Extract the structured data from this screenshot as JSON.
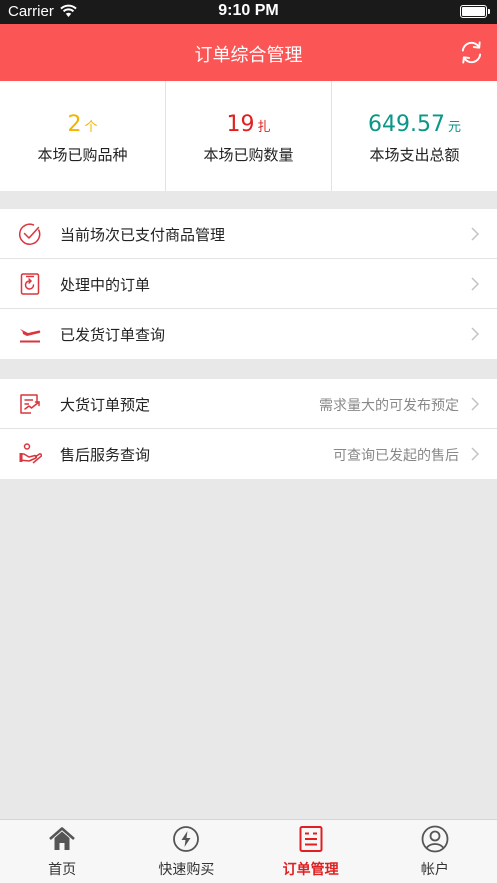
{
  "status_bar": {
    "carrier": "Carrier",
    "time": "9:10 PM"
  },
  "header": {
    "title": "订单综合管理",
    "refresh_icon": "refresh-icon"
  },
  "stats": [
    {
      "value": "2",
      "unit": "个",
      "label": "本场已购品种",
      "color": "#f2b400"
    },
    {
      "value": "19",
      "unit": "扎",
      "label": "本场已购数量",
      "color": "#e02020"
    },
    {
      "value": "649.57",
      "unit": "元",
      "label": "本场支出总额",
      "color": "#0a9688"
    }
  ],
  "menu_group_1": [
    {
      "label": "当前场次已支付商品管理",
      "hint": "",
      "icon": "check-circle-icon"
    },
    {
      "label": "处理中的订单",
      "hint": "",
      "icon": "processing-order-icon"
    },
    {
      "label": "已发货订单查询",
      "hint": "",
      "icon": "shipping-plane-icon"
    }
  ],
  "menu_group_2": [
    {
      "label": "大货订单预定",
      "hint": "需求量大的可发布预定",
      "icon": "bulk-order-icon"
    },
    {
      "label": "售后服务查询",
      "hint": "可查询已发起的售后",
      "icon": "after-sales-icon"
    }
  ],
  "tabs": [
    {
      "label": "首页",
      "icon": "home-icon",
      "active": false
    },
    {
      "label": "快速购买",
      "icon": "quick-buy-icon",
      "active": false
    },
    {
      "label": "订单管理",
      "icon": "order-manage-icon",
      "active": true
    },
    {
      "label": "帐户",
      "icon": "account-icon",
      "active": false
    }
  ],
  "colors": {
    "brand": "#fc5555",
    "accent_red": "#e02020",
    "icon_red": "#d9363e"
  }
}
